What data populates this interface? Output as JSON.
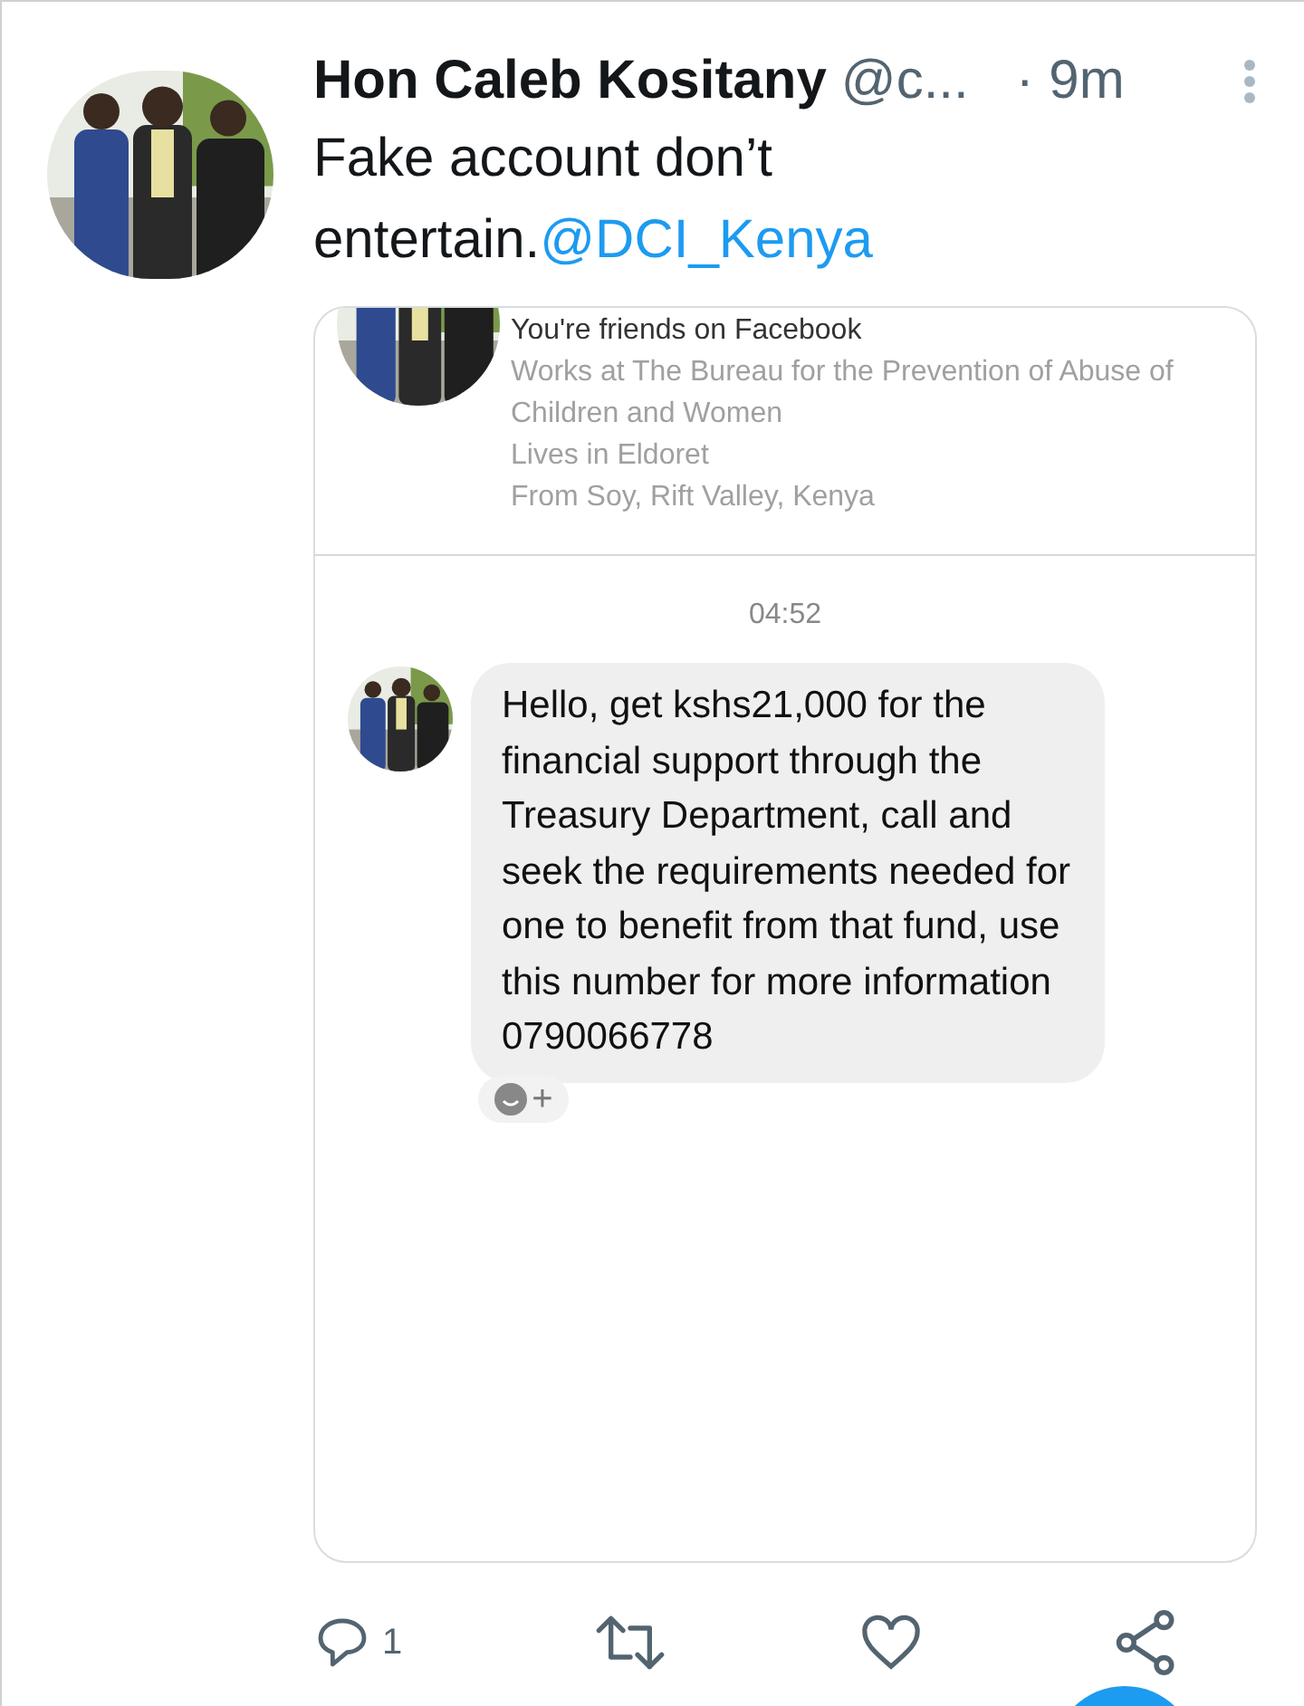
{
  "tweet": {
    "author": "Hon Caleb Kositany",
    "handle": "@c...",
    "time": "· 9m",
    "text": "Fake account don’t entertain.",
    "mention": "@DCI_Kenya"
  },
  "card": {
    "profile": {
      "title": "You're friends on Facebook",
      "details": [
        "Works at The Bureau for the Prevention of Abuse of Children and Women",
        "Lives in Eldoret",
        "From Soy, Rift Valley, Kenya"
      ]
    },
    "timestamp": "04:52",
    "message": {
      "text": "Hello, get kshs21,000 for the financial support through the Treasury Department, call and seek the requirements needed for one to benefit from that fund, use this number for more information",
      "number": "0790066778"
    },
    "reaction_plus": "+"
  },
  "actions": {
    "reply_count": "1"
  }
}
